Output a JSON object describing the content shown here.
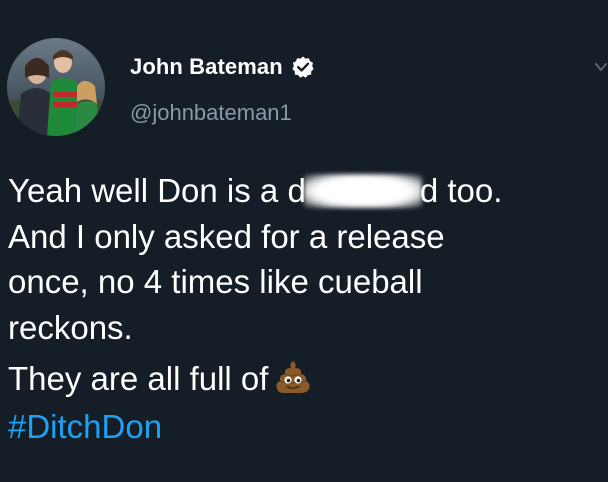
{
  "author": {
    "display_name": "John Bateman",
    "handle": "@johnbateman1",
    "verified": true
  },
  "tweet": {
    "line1_before": "Yeah well Don is a d",
    "line1_after": "d too.",
    "line2": "And I only asked for a release",
    "line3": "once, no 4 times like cueball",
    "line4": "reckons.",
    "line5": "They are all full of",
    "emoji": "poop-emoji",
    "hashtag": "#DitchDon"
  },
  "colors": {
    "background": "#151d27",
    "text": "#ffffff",
    "handle": "#8899a6",
    "link": "#1da1f2",
    "verified_badge": "#ffffff"
  },
  "icons": [
    "verified-badge-icon",
    "more-options-icon",
    "poop-emoji-icon"
  ]
}
